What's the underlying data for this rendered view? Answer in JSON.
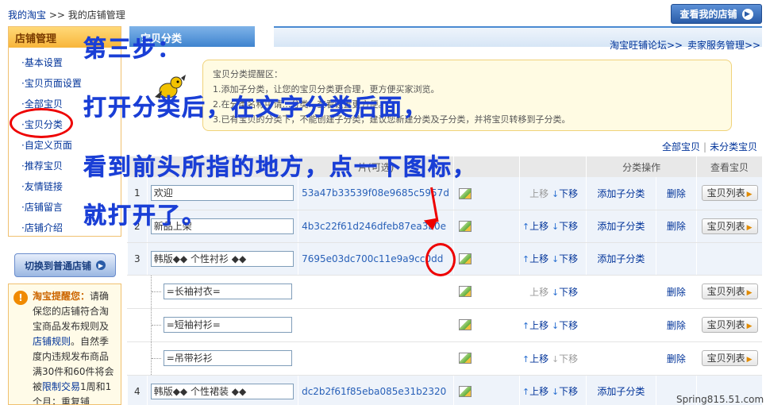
{
  "breadcrumb": {
    "home": "我的淘宝",
    "sep": ">>",
    "current": "我的店铺管理"
  },
  "header": {
    "view_store": "查看我的店铺",
    "arrow": "▶"
  },
  "sidebar": {
    "title": "店铺管理",
    "items": [
      {
        "label": "基本设置"
      },
      {
        "label": "宝贝页面设置"
      },
      {
        "label": "全部宝贝"
      },
      {
        "label": "宝贝分类"
      },
      {
        "label": "自定义页面"
      },
      {
        "label": "推荐宝贝"
      },
      {
        "label": "友情链接"
      },
      {
        "label": "店铺留言"
      },
      {
        "label": "店铺介绍"
      }
    ]
  },
  "switch_button": {
    "label": "切换到普通店铺",
    "arrow": "▶"
  },
  "notice": {
    "icon": "!",
    "title": "淘宝提醒您：",
    "text1": "请确保您的店铺符合淘宝商品发布规则及",
    "link1": "店铺规则",
    "text2": "。自然季度内违规发布商品满30件和60件将会被",
    "link2": "限制交易",
    "text3": "1周和1个月；重复铺"
  },
  "main": {
    "tab": "宝贝分类",
    "forum_link": "淘宝旺铺论坛>>",
    "service_link": "卖家服务管理>>"
  },
  "tips": {
    "title": "宝贝分类提醒区：",
    "lines": [
      "1.添加子分类，让您的宝贝分类更合理，更方便买家浏览。",
      "2.在分类名称中请…分类…查看设置更方便。",
      "3.已有宝贝的分类下，不能创建子分类，建议您新建分类及子分类，并将宝贝转移到子分类。"
    ]
  },
  "filter": {
    "all": "全部宝贝",
    "sep": "|",
    "uncat": "未分类宝贝"
  },
  "table": {
    "headers": {
      "img": "片(可选)",
      "ops": "分类操作",
      "view": "查看宝贝"
    },
    "move_up": "上移",
    "move_down": "下移",
    "up_arrow": "↑",
    "down_arrow": "↓",
    "add_sub": "添加子分类",
    "delete": "删除",
    "list": "宝贝列表",
    "list_arrow": "▶",
    "rows": [
      {
        "num": "1",
        "name": "欢迎",
        "img": "53a47b33539f08e9685c5957d"
      },
      {
        "num": "2",
        "name": "新品上架",
        "img": "4b3c22f61d246dfeb87ea3b0e"
      },
      {
        "num": "3",
        "name": "韩版◆◆ 个性衬衫 ◆◆",
        "img": "7695e03dc700c11e9a9cc0dd"
      },
      {
        "name": "=长袖衬衣="
      },
      {
        "name": "=短袖衬衫="
      },
      {
        "name": "=吊带衫衫"
      },
      {
        "num": "4",
        "name": "韩版◆◆ 个性裙装 ◆◆",
        "img": "dc2b2f61f85eba085e31b2320"
      }
    ]
  },
  "overlay": {
    "line1": "第三步：",
    "line2": "打开分类后，在文字分类后面，",
    "line3": "看到前头所指的地方，点一下图标，",
    "line4": "就打开了。"
  },
  "watermark": "Spring815.51.com"
}
